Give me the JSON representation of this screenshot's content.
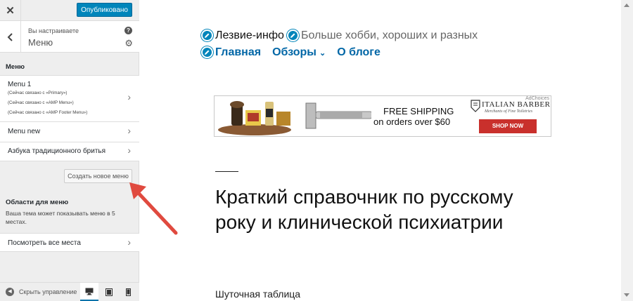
{
  "sidebar": {
    "close_label": "✕",
    "publish_label": "Опубликовано",
    "breadcrumb_sub": "Вы настраиваете",
    "breadcrumb_title": "Меню",
    "menus_section_label": "Меню",
    "menus": [
      {
        "name": "Menu 1",
        "notes": [
          "(Сейчас связано с «Primary»)",
          "(Сейчас связано с «AMP Menu»)",
          "(Сейчас связано с «AMP Footer Menu»)"
        ]
      },
      {
        "name": "Menu new",
        "notes": []
      },
      {
        "name": "Азбука традиционного бритья",
        "notes": []
      }
    ],
    "create_menu_label": "Создать новое меню",
    "locations_title": "Области для меню",
    "locations_desc": "Ваша тема может показывать меню в 5 местах.",
    "view_locations_label": "Посмотреть все места",
    "collapse_label": "Скрыть управление"
  },
  "preview": {
    "site_title": "Лезвие-инфо",
    "tagline": "Больше хобби, хороших и разных",
    "nav": [
      "Главная",
      "Обзоры",
      "О блоге"
    ],
    "ad": {
      "line1": "FREE SHIPPING",
      "line2": "on orders over $60",
      "brand": "ITALIAN BARBER",
      "brand_sub": "Merchants of Fine Toiletries",
      "cta": "SHOP NOW",
      "adchoices": "AdChoices"
    },
    "post_title": "Краткий справочник по русскому року и клинической психиатрии",
    "post_subheading": "Шуточная таблица"
  },
  "colors": {
    "accent": "#0085ba",
    "nav_link": "#0066a6",
    "arrow": "#e04a3f",
    "shop_button": "#c9302c"
  }
}
